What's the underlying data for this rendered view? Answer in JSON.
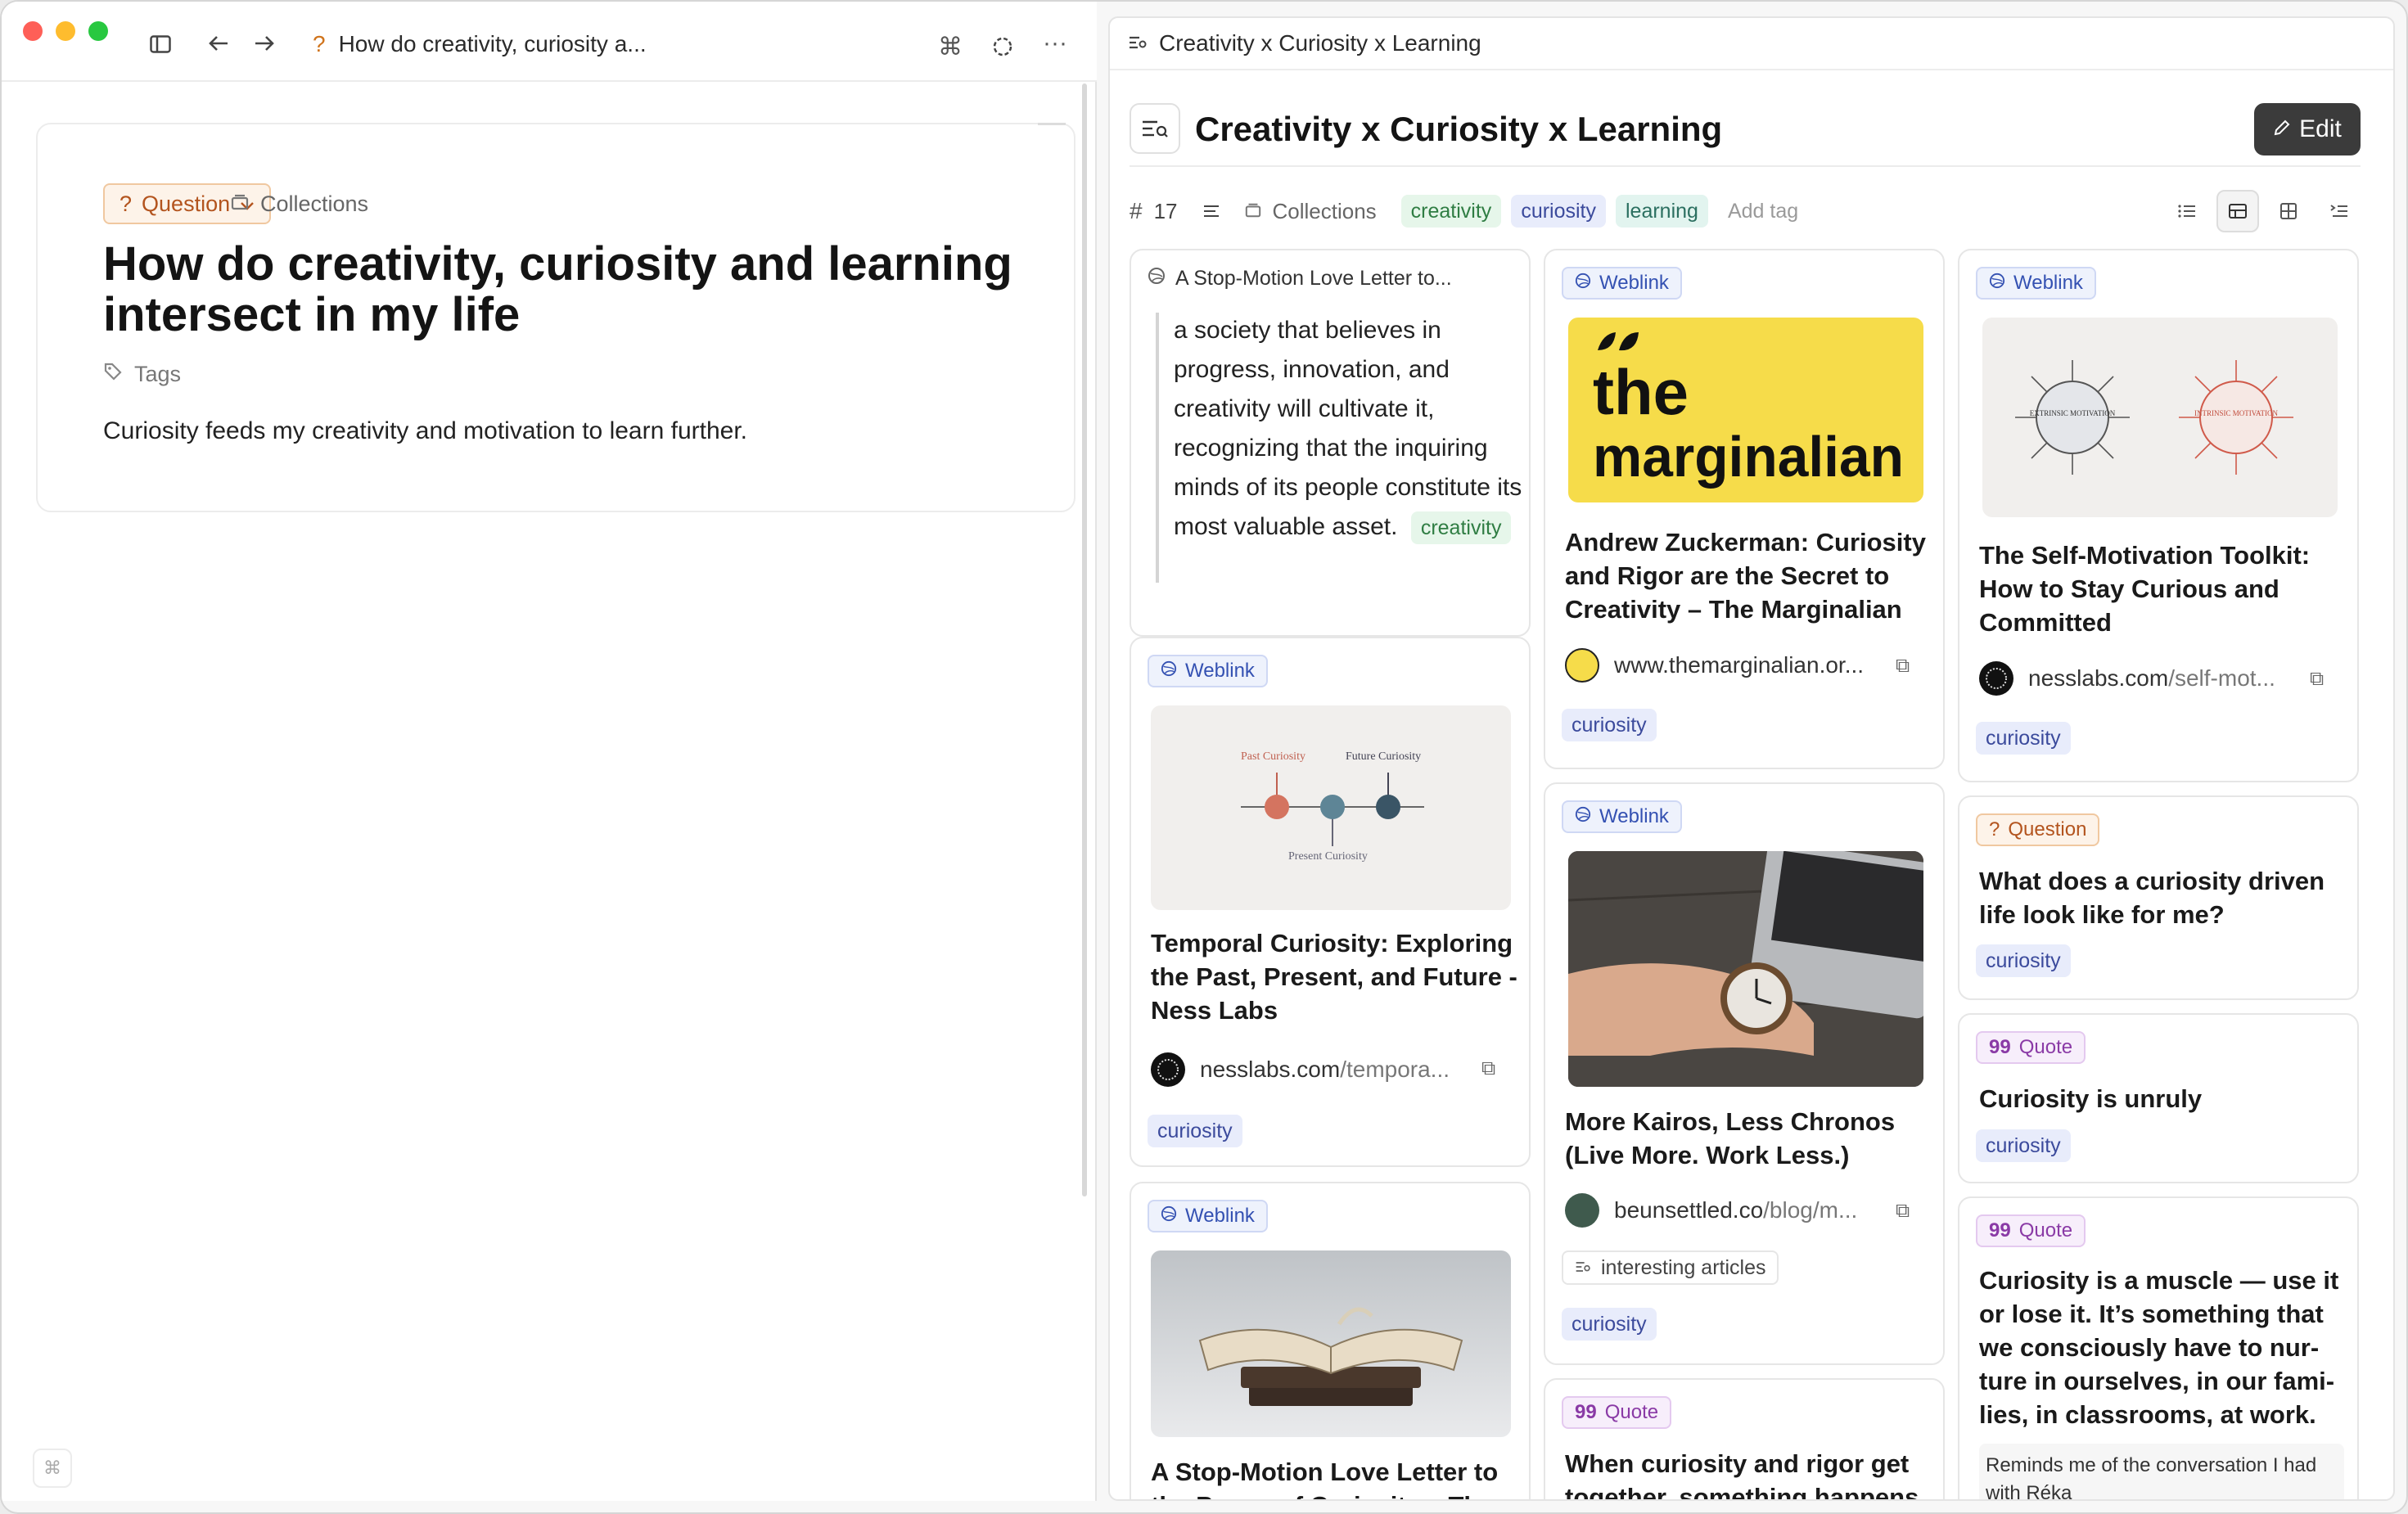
{
  "left": {
    "tab_title": "How do creativity, curiosity a...",
    "chip_label": "Question",
    "collections_label": "Collections",
    "doc_title": "How do creativity, curiosity and learning intersect in my life",
    "tags_label": "Tags",
    "body": "Curiosity feeds my creativity and motivation to learn further."
  },
  "right": {
    "header": "Creativity x Curiosity x Learning",
    "title": "Creativity x Curiosity x Learning",
    "edit_label": "Edit",
    "count": "17",
    "collections_label": "Collections",
    "tags": [
      "creativity",
      "curiosity",
      "learning"
    ],
    "add_tag": "Add tag"
  },
  "cards": {
    "c1": {
      "header": "A Stop-Motion Love Letter to...",
      "quote": "a society that believes in progress, innovation, and creativity will cultivate it, recognizing that the inquiring minds of its people constitute its most valuable asset.",
      "tag": "creativity"
    },
    "c2": {
      "badge": "Weblink",
      "title": "Temporal Curiosity: Exploring the Past, Present, and Future - Ness Labs",
      "domain": "nesslabs.com",
      "path": "/tempora...",
      "tag": "curiosity",
      "thumb_labels": [
        "Past Curiosity",
        "Future Curiosity",
        "Present Curiosity"
      ]
    },
    "c3": {
      "badge": "Weblink",
      "title": "A Stop-Motion Love Letter to the Power of Curiosity – The"
    },
    "c4": {
      "badge": "Weblink",
      "title": "Andrew Zuckerman: Curiosity and Rigor are the Secret to Creativity – The Marginalian",
      "domain": "www.themarginalian.or...",
      "tag": "curiosity",
      "logo_line1": "the",
      "logo_line2": "marginalian"
    },
    "c5": {
      "badge": "Weblink",
      "title": "More Kairos, Less Chronos (Live More. Work Less.)",
      "domain": "beunsettled.co",
      "path": "/blog/m...",
      "collection": "interesting articles",
      "tag": "curiosity"
    },
    "c6": {
      "badge": "Quote",
      "title": "When curiosity and rigor get together, something happens."
    },
    "c7": {
      "badge": "Weblink",
      "title": "The Self-Motivation Toolkit: How to Stay Curious and Committed",
      "domain": "nesslabs.com",
      "path": "/self-mot...",
      "tag": "curiosity",
      "thumb_labels": [
        "EXTRINSIC MOTIVATION",
        "INTRINSIC MOTIVATION"
      ]
    },
    "c8": {
      "badge": "Question",
      "title": "What does a curiosity driven life look like for me?",
      "tag": "curiosity"
    },
    "c9": {
      "badge": "Quote",
      "title": "Curiosity is unruly",
      "tag": "curiosity"
    },
    "c10": {
      "badge": "Quote",
      "title": "Curiosity is a muscle — use it or lose it. It’s something that we consciously have to nur-ture in ourselves, in our fami-lies, in classrooms, at work.",
      "note": "Reminds me of the conversation I had with Réka"
    }
  }
}
